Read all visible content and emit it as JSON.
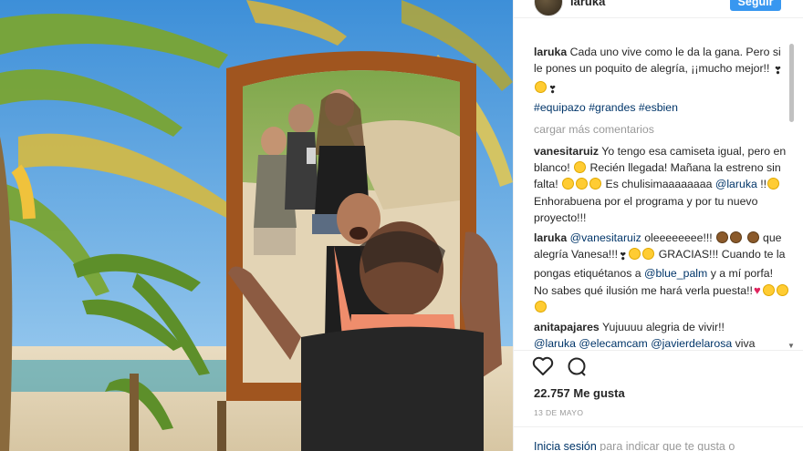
{
  "header": {
    "username": "laruka",
    "follow_label": "Seguir"
  },
  "caption": {
    "username": "laruka",
    "text": "Cada uno vive como le da la gana. Pero si le pones un poquito de alegría, ¡¡mucho mejor!!",
    "hashtags": [
      "#equipazo",
      "#grandes",
      "#esbien"
    ]
  },
  "load_more": "cargar más comentarios",
  "comments": [
    {
      "username": "vanesitaruiz",
      "text_a": "Yo tengo esa camiseta igual, pero en blanco!",
      "text_b": "Recién llegada! Mañana la estreno sin falta!",
      "text_c": "Es chulisimaaaaaaaa",
      "mention": "@laruka",
      "text_d": "!!",
      "text_e": "Enhorabuena por el programa y por tu nuevo proyecto!!!"
    },
    {
      "username": "laruka",
      "mention": "@vanesitaruiz",
      "text_a": "oleeeeeeee!!!",
      "text_b": "que alegría Vanesa!!!",
      "text_c": "GRACIAS!!! Cuando te la pongas etiquétanos a",
      "mention2": "@blue_palm",
      "text_d": "y a mí porfa! No sabes qué ilusión me hará verla puesta!!"
    },
    {
      "username": "anitapajares",
      "text_a": "Yujuuuu alegria de vivir!!",
      "mentions": [
        "@laruka",
        "@elecamcam",
        "@javierdelarosa"
      ],
      "text_b": "viva"
    }
  ],
  "icons": [
    "heart-icon",
    "comment-icon",
    "avatar",
    "scroll-down-arrow-icon"
  ],
  "likes": "22.757 Me gusta",
  "date": "13 DE MAYO",
  "login": {
    "link": "Inicia sesión",
    "text": "para indicar que te gusta o"
  },
  "colors": {
    "accent": "#3897f0",
    "link": "#003569",
    "muted": "#999999"
  }
}
